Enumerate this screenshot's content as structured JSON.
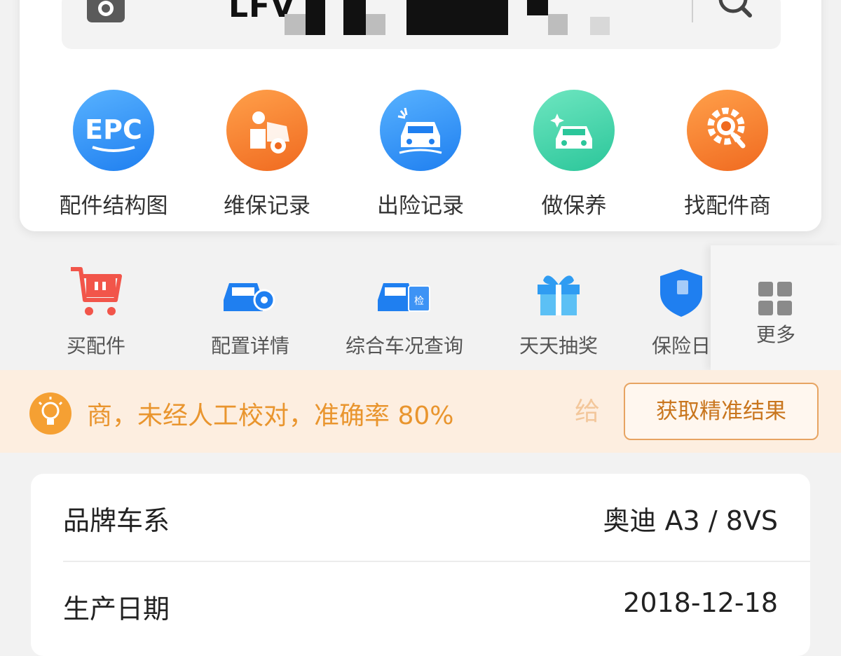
{
  "search": {
    "vin_prefix": "LFV"
  },
  "features": [
    {
      "label": "配件结构图",
      "icon": "epc-icon",
      "badge": "EPC"
    },
    {
      "label": "维保记录",
      "icon": "mechanic-repair-icon"
    },
    {
      "label": "出险记录",
      "icon": "car-accident-icon"
    },
    {
      "label": "做保养",
      "icon": "car-maintenance-icon"
    },
    {
      "label": "找配件商",
      "icon": "gear-search-icon"
    }
  ],
  "tools": [
    {
      "label": "买配件",
      "icon": "shopping-cart-icon"
    },
    {
      "label": "配置详情",
      "icon": "car-config-icon"
    },
    {
      "label": "综合车况查询",
      "icon": "car-inspect-icon",
      "badge": "检"
    },
    {
      "label": "天天抽奖",
      "icon": "gift-box-icon"
    },
    {
      "label": "保险日",
      "icon": "insurance-shield-icon"
    }
  ],
  "more": {
    "label": "更多"
  },
  "notice": {
    "text": "商，未经人工校对，准确率 80%",
    "trailing": "给",
    "button": "获取精准结果"
  },
  "vehicle_info": [
    {
      "key": "品牌车系",
      "value": "奥迪 A3 / 8VS"
    },
    {
      "key": "生产日期",
      "value": "2018-12-18"
    }
  ],
  "colors": {
    "accent_orange": "#e9952e",
    "blue": "#1f7ff0",
    "teal": "#2bc69a",
    "cart_red": "#f2554a"
  }
}
